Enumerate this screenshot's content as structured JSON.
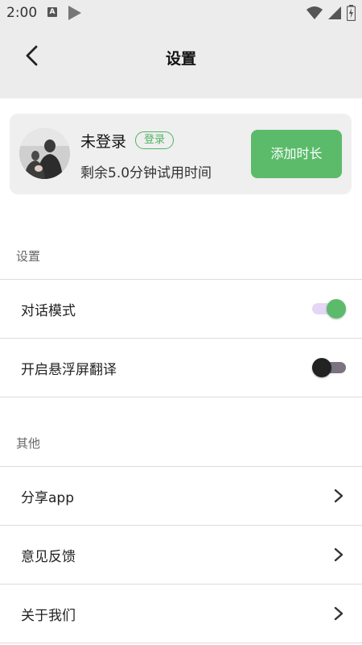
{
  "status_bar": {
    "time": "2:00",
    "notification_letter": "A"
  },
  "header": {
    "title": "设置"
  },
  "user_card": {
    "name": "未登录",
    "login_label": "登录",
    "trial_text": "剩余5.0分钟试用时间",
    "add_time_label": "添加时长"
  },
  "sections": {
    "settings": {
      "title": "设置",
      "items": [
        {
          "label": "对话模式",
          "enabled": true
        },
        {
          "label": "开启悬浮屏翻译",
          "enabled": false
        }
      ]
    },
    "other": {
      "title": "其他",
      "items": [
        {
          "label": "分享app"
        },
        {
          "label": "意见反馈"
        },
        {
          "label": "关于我们"
        }
      ]
    }
  },
  "colors": {
    "accent_green": "#5bbb6b",
    "toggle_on_track": "#e4d7f5",
    "toggle_off_track": "#7b7480",
    "toggle_off_thumb": "#222222",
    "header_bg": "#ececec"
  }
}
